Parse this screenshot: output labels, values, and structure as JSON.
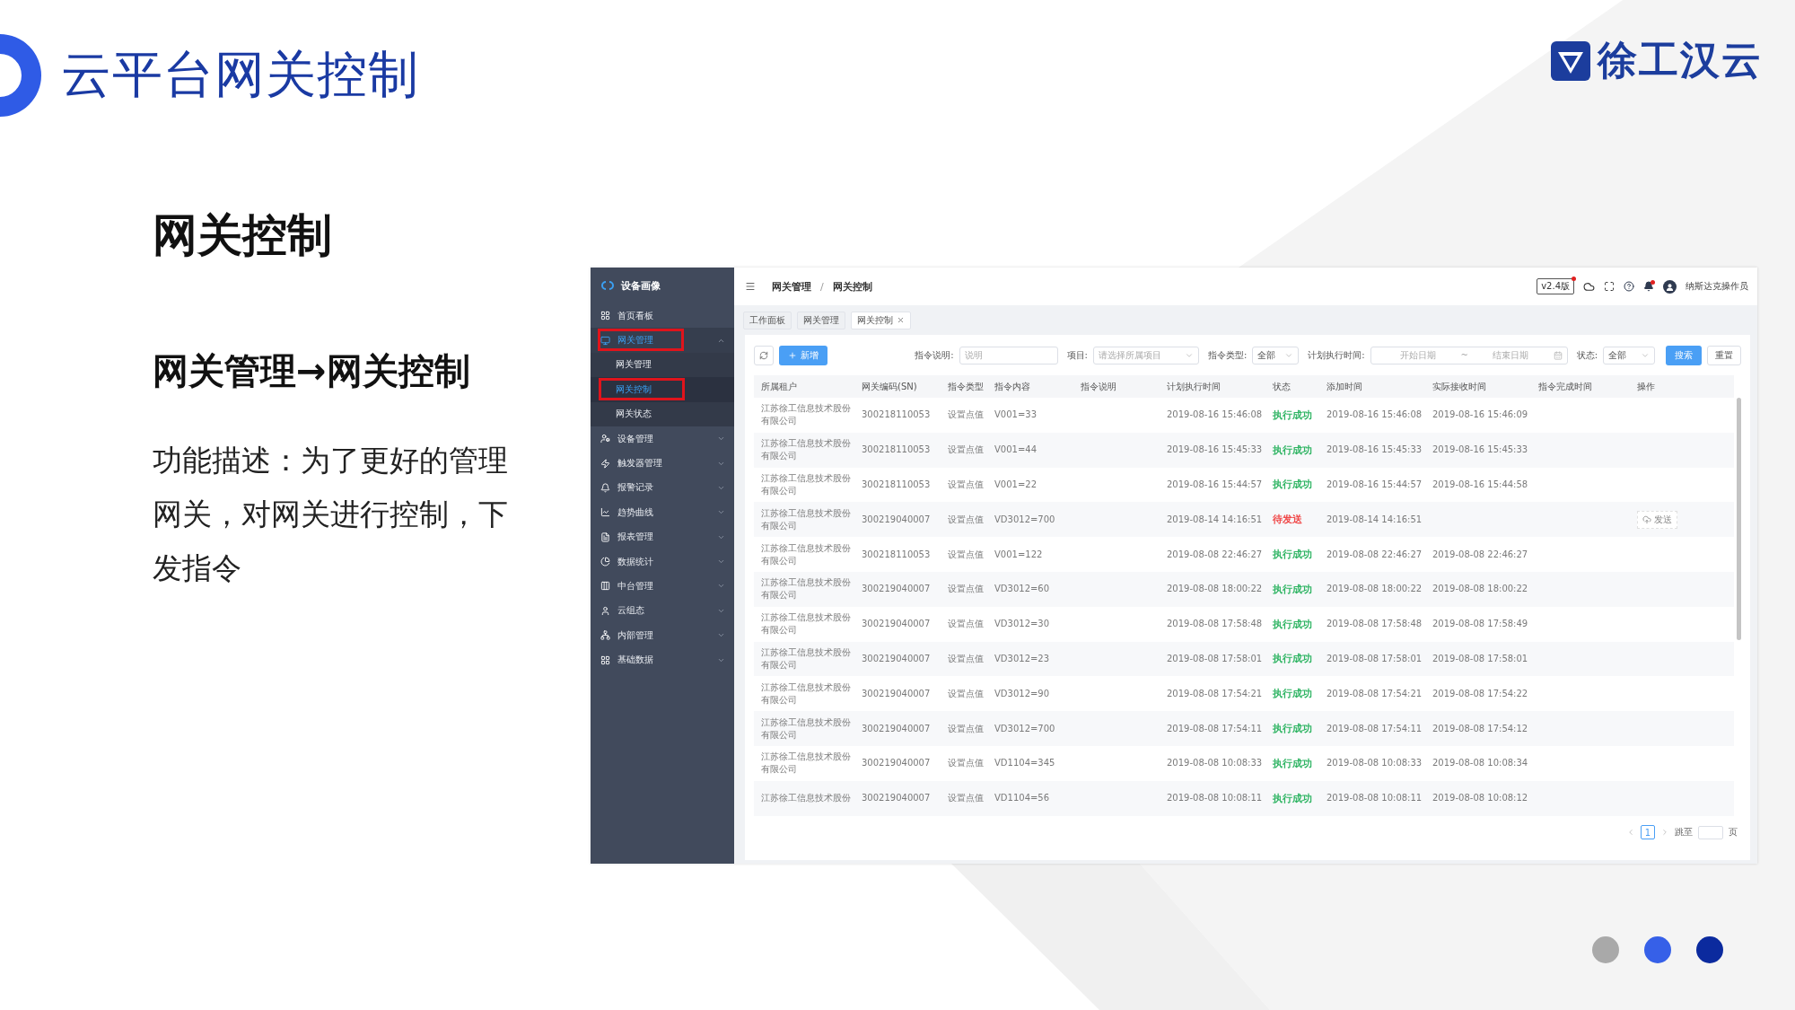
{
  "slide": {
    "title": "云平台网关控制",
    "logo_text": "徐工汉云",
    "heading": "网关控制",
    "subheading": "网关管理→网关控制",
    "description": "功能描述：为了更好的管理网关，对网关进行控制，下发指令",
    "pager_dots": [
      {
        "color": "#a9a9a9"
      },
      {
        "color": "#3660e8"
      },
      {
        "color": "#0b2a9e"
      }
    ]
  },
  "app": {
    "sidebar": {
      "brand": "设备画像",
      "items": [
        {
          "label": "首页看板",
          "selected": false,
          "expanded": false,
          "annotated": false
        },
        {
          "label": "网关管理",
          "selected": true,
          "expanded": true,
          "annotated": true,
          "children": [
            {
              "label": "网关管理",
              "selected": false,
              "annotated": false
            },
            {
              "label": "网关控制",
              "selected": true,
              "annotated": true
            },
            {
              "label": "网关状态",
              "selected": false,
              "annotated": false
            }
          ]
        },
        {
          "label": "设备管理",
          "selected": false,
          "expanded": false,
          "annotated": false
        },
        {
          "label": "触发器管理",
          "selected": false,
          "expanded": false,
          "annotated": false
        },
        {
          "label": "报警记录",
          "selected": false,
          "expanded": false,
          "annotated": false
        },
        {
          "label": "趋势曲线",
          "selected": false,
          "expanded": false,
          "annotated": false
        },
        {
          "label": "报表管理",
          "selected": false,
          "expanded": false,
          "annotated": false
        },
        {
          "label": "数据统计",
          "selected": false,
          "expanded": false,
          "annotated": false
        },
        {
          "label": "中台管理",
          "selected": false,
          "expanded": false,
          "annotated": false
        },
        {
          "label": "云组态",
          "selected": false,
          "expanded": false,
          "annotated": false
        },
        {
          "label": "内部管理",
          "selected": false,
          "expanded": false,
          "annotated": false
        },
        {
          "label": "基础数据",
          "selected": false,
          "expanded": false,
          "annotated": false
        }
      ]
    },
    "header": {
      "breadcrumb": [
        "网关管理",
        "网关控制"
      ],
      "breadcrumb_separator": "/",
      "version": "v2.4版",
      "user": "纳斯达克操作员"
    },
    "tabs": [
      {
        "label": "工作面板",
        "selected": false,
        "closable": false
      },
      {
        "label": "网关管理",
        "selected": false,
        "closable": false
      },
      {
        "label": "网关控制",
        "selected": true,
        "closable": true
      }
    ],
    "toolbar": {
      "new_button": "新增",
      "search_button": "搜索",
      "reset_button": "重置",
      "filters": [
        {
          "kind": "input",
          "label": "指令说明:",
          "placeholder": "说明"
        },
        {
          "kind": "select",
          "label": "项目:",
          "placeholder": "请选择所属项目"
        },
        {
          "kind": "select",
          "label": "指令类型:",
          "value": "全部"
        },
        {
          "kind": "daterange",
          "label": "计划执行时间:",
          "start_placeholder": "开始日期",
          "separator": "~",
          "end_placeholder": "结束日期"
        },
        {
          "kind": "select",
          "label": "状态:",
          "value": "全部"
        }
      ]
    },
    "table": {
      "columns": [
        "所属租户",
        "网关编码(SN)",
        "指令类型",
        "指令内容",
        "指令说明",
        "计划执行时间",
        "状态",
        "添加时间",
        "实际接收时间",
        "指令完成时间",
        "操作"
      ],
      "rows": [
        {
          "tenant": "江苏徐工信息技术股份有限公司",
          "sn": "300218110053",
          "type": "设置点值",
          "content": "V001=33",
          "planned": "2019-08-16 15:46:08",
          "status": {
            "text": "执行成功",
            "color": "#2fb463"
          },
          "added": "2019-08-16 15:46:08",
          "received": "2019-08-16 15:46:09"
        },
        {
          "tenant": "江苏徐工信息技术股份有限公司",
          "sn": "300218110053",
          "type": "设置点值",
          "content": "V001=44",
          "planned": "2019-08-16 15:45:33",
          "status": {
            "text": "执行成功",
            "color": "#2fb463"
          },
          "added": "2019-08-16 15:45:33",
          "received": "2019-08-16 15:45:33"
        },
        {
          "tenant": "江苏徐工信息技术股份有限公司",
          "sn": "300218110053",
          "type": "设置点值",
          "content": "V001=22",
          "planned": "2019-08-16 15:44:57",
          "status": {
            "text": "执行成功",
            "color": "#2fb463"
          },
          "added": "2019-08-16 15:44:57",
          "received": "2019-08-16 15:44:58"
        },
        {
          "tenant": "江苏徐工信息技术股份有限公司",
          "sn": "300219040007",
          "type": "设置点值",
          "content": "VD3012=700",
          "planned": "2019-08-14 14:16:51",
          "status": {
            "text": "待发送",
            "color": "#f04a4a"
          },
          "added": "2019-08-14 14:16:51",
          "action": "发送"
        },
        {
          "tenant": "江苏徐工信息技术股份有限公司",
          "sn": "300218110053",
          "type": "设置点值",
          "content": "V001=122",
          "planned": "2019-08-08 22:46:27",
          "status": {
            "text": "执行成功",
            "color": "#2fb463"
          },
          "added": "2019-08-08 22:46:27",
          "received": "2019-08-08 22:46:27"
        },
        {
          "tenant": "江苏徐工信息技术股份有限公司",
          "sn": "300219040007",
          "type": "设置点值",
          "content": "VD3012=60",
          "planned": "2019-08-08 18:00:22",
          "status": {
            "text": "执行成功",
            "color": "#2fb463"
          },
          "added": "2019-08-08 18:00:22",
          "received": "2019-08-08 18:00:22"
        },
        {
          "tenant": "江苏徐工信息技术股份有限公司",
          "sn": "300219040007",
          "type": "设置点值",
          "content": "VD3012=30",
          "planned": "2019-08-08 17:58:48",
          "status": {
            "text": "执行成功",
            "color": "#2fb463"
          },
          "added": "2019-08-08 17:58:48",
          "received": "2019-08-08 17:58:49"
        },
        {
          "tenant": "江苏徐工信息技术股份有限公司",
          "sn": "300219040007",
          "type": "设置点值",
          "content": "VD3012=23",
          "planned": "2019-08-08 17:58:01",
          "status": {
            "text": "执行成功",
            "color": "#2fb463"
          },
          "added": "2019-08-08 17:58:01",
          "received": "2019-08-08 17:58:01"
        },
        {
          "tenant": "江苏徐工信息技术股份有限公司",
          "sn": "300219040007",
          "type": "设置点值",
          "content": "VD3012=90",
          "planned": "2019-08-08 17:54:21",
          "status": {
            "text": "执行成功",
            "color": "#2fb463"
          },
          "added": "2019-08-08 17:54:21",
          "received": "2019-08-08 17:54:22"
        },
        {
          "tenant": "江苏徐工信息技术股份有限公司",
          "sn": "300219040007",
          "type": "设置点值",
          "content": "VD3012=700",
          "planned": "2019-08-08 17:54:11",
          "status": {
            "text": "执行成功",
            "color": "#2fb463"
          },
          "added": "2019-08-08 17:54:11",
          "received": "2019-08-08 17:54:12"
        },
        {
          "tenant": "江苏徐工信息技术股份有限公司",
          "sn": "300219040007",
          "type": "设置点值",
          "content": "VD1104=345",
          "planned": "2019-08-08 10:08:33",
          "status": {
            "text": "执行成功",
            "color": "#2fb463"
          },
          "added": "2019-08-08 10:08:33",
          "received": "2019-08-08 10:08:34"
        },
        {
          "tenant": "江苏徐工信息技术股份",
          "sn": "300219040007",
          "type": "设置点值",
          "content": "VD1104=56",
          "planned": "2019-08-08 10:08:11",
          "status": {
            "text": "执行成功",
            "color": "#2fb463"
          },
          "added": "2019-08-08 10:08:11",
          "received": "2019-08-08 10:08:12"
        }
      ]
    },
    "pagination": {
      "current": "1",
      "jump_label": "跳至",
      "page_suffix": "页"
    }
  }
}
